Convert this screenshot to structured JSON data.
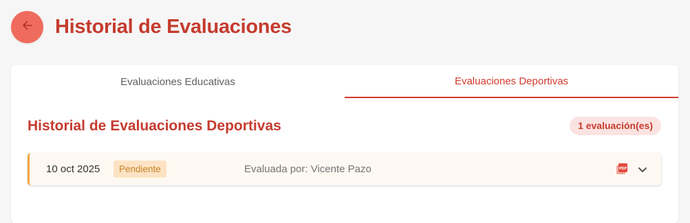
{
  "header": {
    "title": "Historial de Evaluaciones",
    "back_icon": "arrow-left-icon"
  },
  "tabs": [
    {
      "label": "Evaluaciones Educativas",
      "active": false
    },
    {
      "label": "Evaluaciones Deportivas",
      "active": true
    }
  ],
  "section": {
    "title": "Historial de Evaluaciones Deportivas",
    "count_label": "1 evaluación(es)"
  },
  "evaluations": [
    {
      "date": "10 oct 2025",
      "status": "Pendiente",
      "evaluator": "Evaluada por: Vicente Pazo",
      "pdf_icon": "pdf-icon",
      "expand_icon": "chevron-down-icon"
    }
  ],
  "colors": {
    "accent": "#c53b2e",
    "back_button": "#ef6b5e",
    "pending_border": "#f3a640",
    "pending_badge_bg": "#fde3c4",
    "pending_badge_text": "#c78226"
  }
}
